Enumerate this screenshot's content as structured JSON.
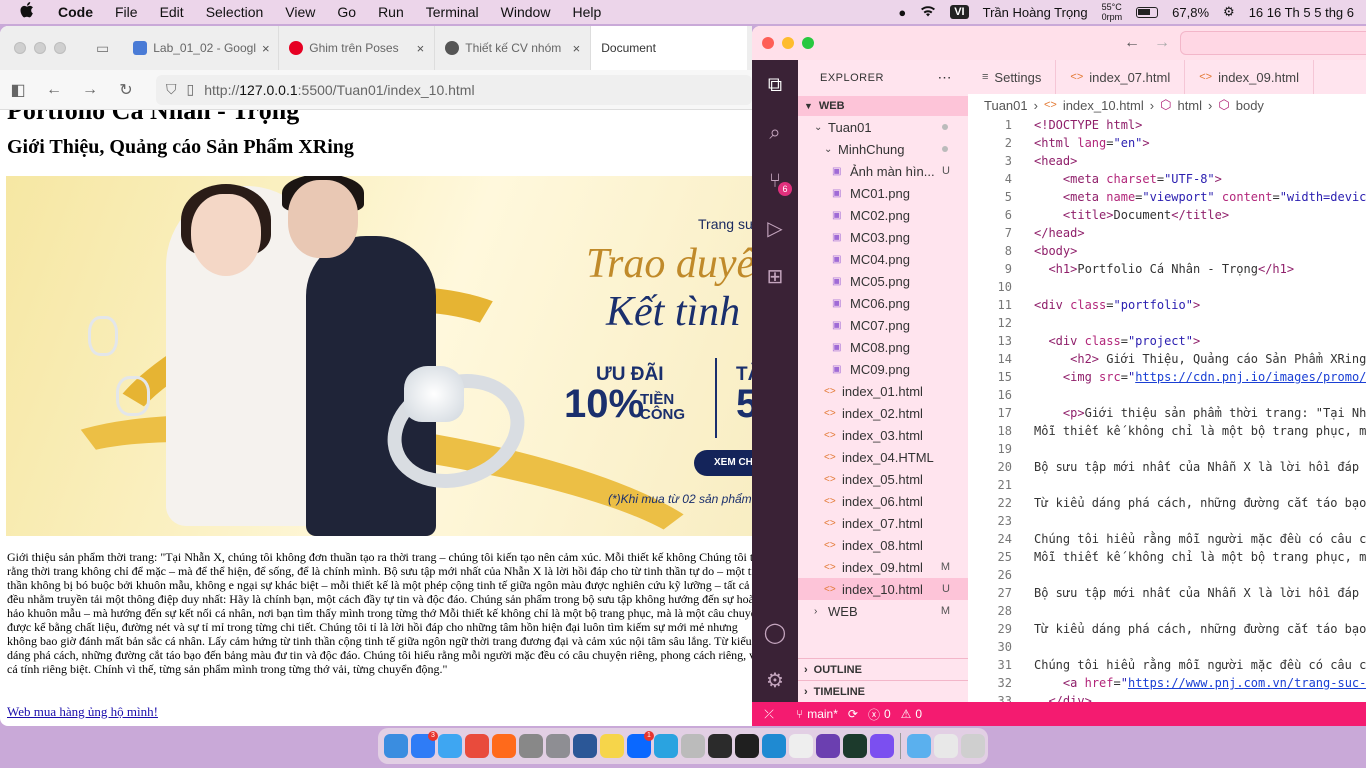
{
  "menubar": {
    "app_name": "Code",
    "items": [
      "File",
      "Edit",
      "Selection",
      "View",
      "Go",
      "Run",
      "Terminal",
      "Window",
      "Help"
    ],
    "input_method": "VI",
    "user_name": "Trần Hoàng Trọng",
    "temp": "55°C",
    "fan": "0rpm",
    "battery": "67,8%",
    "datetime": "16 16 Th 5 5 thg 6"
  },
  "browser": {
    "tabs": [
      {
        "label": "Lab_01_02 - Googl",
        "icon_color": "#4a7bd6"
      },
      {
        "label": "Ghim trên Poses",
        "icon_color": "#e60023"
      },
      {
        "label": "Thiết kế CV nhóm",
        "icon_color": "#555555"
      },
      {
        "label": "Document",
        "icon_color": ""
      }
    ],
    "url_prefix": "http://",
    "url_host": "127.0.0.1",
    "url_rest": ":5500/Tuan01/index_10.html"
  },
  "page": {
    "h1": "Portfolio Cá Nhân - Trọng",
    "h2": "Giới Thiệu, Quảng cáo Sản Phẩm XRing",
    "banner": {
      "trang": "Trang sư",
      "title1": "Trao duyên",
      "title2": "Kết tình T",
      "uudai": "ƯU ĐÃI",
      "pct": "10%",
      "tiencong": "TIỀN\nCÔNG",
      "t": "TẶ",
      "five": "5",
      "button": "XEM CH",
      "note": "(*)Khi mua từ 02 sản phẩm"
    },
    "description": "Giới thiệu sản phẩm thời trang: \"Tại Nhẫn X, chúng tôi không đơn thuần tạo ra thời trang – chúng tôi kiến tạo nên cảm xúc. Mỗi thiết kế không Chúng tôi tin rằng thời trang không chỉ để mặc – mà để thể hiện, để sống, để là chính mình. Bộ sưu tập mới nhất của Nhẫn X là lời hồi đáp cho từ tinh thần tự do – một tinh thần không bị bó buộc bởi khuôn mẫu, không e ngại sự khác biệt – mỗi thiết kế là một phép cộng tinh tế giữa ngôn màu được nghiên cứu kỹ lưỡng – tất cả đều nhằm truyền tải một thông điệp duy nhất: Hãy là chính bạn, một cách đầy tự tin và độc đáo. Chúng sản phẩm trong bộ sưu tập không hướng đến sự hoàn hảo khuôn mẫu – mà hướng đến sự kết nối cá nhân, nơi bạn tìm thấy mình trong từng thớ Mỗi thiết kế không chỉ là một bộ trang phục, mà là một câu chuyện được kể bằng chất liệu, đường nét và sự tỉ mỉ trong từng chi tiết. Chúng tôi tỉ là lời hồi đáp cho những tâm hồn hiện đại luôn tìm kiếm sự mới mẻ nhưng không bao giờ đánh mất bản sắc cá nhân. Lấy cảm hứng từ tinh thần cộng tinh tế giữa ngôn ngữ thời trang đương đại và cảm xúc nội tâm sâu lắng. Từ kiểu dáng phá cách, những đường cắt táo bạo đến bảng màu đư tin và độc đáo. Chúng tôi hiểu rằng mỗi người mặc đều có câu chuyện riêng, phong cách riêng, và cá tính riêng biệt. Chính vì thế, từng sản phẩm mình trong từng thớ vải, từng chuyển động.\"",
    "link": "Web mua hàng ủng hộ mình!"
  },
  "vscode": {
    "explorer_title": "EXPLORER",
    "workspace": "WEB",
    "tree": [
      {
        "label": "Tuan01",
        "type": "folder",
        "depth": 1,
        "open": true,
        "status": "",
        "dot": true
      },
      {
        "label": "MinhChung",
        "type": "folder",
        "depth": 2,
        "open": true,
        "status": "",
        "dot": true
      },
      {
        "label": "Ảnh màn hìn...",
        "type": "image",
        "depth": 3,
        "status": "U"
      },
      {
        "label": "MC01.png",
        "type": "image",
        "depth": 3,
        "status": ""
      },
      {
        "label": "MC02.png",
        "type": "image",
        "depth": 3,
        "status": ""
      },
      {
        "label": "MC03.png",
        "type": "image",
        "depth": 3,
        "status": ""
      },
      {
        "label": "MC04.png",
        "type": "image",
        "depth": 3,
        "status": ""
      },
      {
        "label": "MC05.png",
        "type": "image",
        "depth": 3,
        "status": ""
      },
      {
        "label": "MC06.png",
        "type": "image",
        "depth": 3,
        "status": ""
      },
      {
        "label": "MC07.png",
        "type": "image",
        "depth": 3,
        "status": ""
      },
      {
        "label": "MC08.png",
        "type": "image",
        "depth": 3,
        "status": ""
      },
      {
        "label": "MC09.png",
        "type": "image",
        "depth": 3,
        "status": ""
      },
      {
        "label": "index_01.html",
        "type": "html",
        "depth": 2,
        "status": ""
      },
      {
        "label": "index_02.html",
        "type": "html",
        "depth": 2,
        "status": ""
      },
      {
        "label": "index_03.html",
        "type": "html",
        "depth": 2,
        "status": ""
      },
      {
        "label": "index_04.HTML",
        "type": "html",
        "depth": 2,
        "status": ""
      },
      {
        "label": "index_05.html",
        "type": "html",
        "depth": 2,
        "status": ""
      },
      {
        "label": "index_06.html",
        "type": "html",
        "depth": 2,
        "status": ""
      },
      {
        "label": "index_07.html",
        "type": "html",
        "depth": 2,
        "status": ""
      },
      {
        "label": "index_08.html",
        "type": "html",
        "depth": 2,
        "status": ""
      },
      {
        "label": "index_09.html",
        "type": "html",
        "depth": 2,
        "status": "M"
      },
      {
        "label": "index_10.html",
        "type": "html",
        "depth": 2,
        "status": "U",
        "selected": true
      },
      {
        "label": "WEB",
        "type": "folder",
        "depth": 1,
        "open": false,
        "status": "M"
      }
    ],
    "outline": "OUTLINE",
    "timeline": "TIMELINE",
    "tabs": [
      {
        "label": "Settings",
        "icon": "≡"
      },
      {
        "label": "index_07.html",
        "icon": "<>"
      },
      {
        "label": "index_09.html",
        "icon": "<>"
      }
    ],
    "breadcrumb": [
      "Tuan01",
      "index_10.html",
      "html",
      "body"
    ],
    "scm_badge": "6",
    "status": {
      "branch": "main*",
      "errors": "0",
      "warnings": "0"
    },
    "code_lines": [
      {
        "n": "1",
        "html": "<span class=\"tg\">&lt;!DOCTYPE html&gt;</span>"
      },
      {
        "n": "2",
        "html": "<span class=\"tg\">&lt;html</span> <span class=\"at\">lang</span>=<span class=\"sv\">\"en\"</span><span class=\"tg\">&gt;</span>"
      },
      {
        "n": "3",
        "html": "<span class=\"tg\">&lt;head&gt;</span>"
      },
      {
        "n": "4",
        "html": "    <span class=\"tg\">&lt;meta</span> <span class=\"at\">charset</span>=<span class=\"sv\">\"UTF-8\"</span><span class=\"tg\">&gt;</span>"
      },
      {
        "n": "5",
        "html": "    <span class=\"tg\">&lt;meta</span> <span class=\"at\">name</span>=<span class=\"sv\">\"viewport\"</span> <span class=\"at\">content</span>=<span class=\"sv\">\"width=devic</span>"
      },
      {
        "n": "6",
        "html": "    <span class=\"tg\">&lt;title&gt;</span>Document<span class=\"tg\">&lt;/title&gt;</span>"
      },
      {
        "n": "7",
        "html": "<span class=\"tg\">&lt;/head&gt;</span>"
      },
      {
        "n": "8",
        "html": "<span class=\"tg\">&lt;body&gt;</span>"
      },
      {
        "n": "9",
        "html": "  <span class=\"tg\">&lt;h1&gt;</span>Portfolio Cá Nhân - Trọng<span class=\"tg\">&lt;/h1&gt;</span>"
      },
      {
        "n": "10",
        "html": ""
      },
      {
        "n": "11",
        "html": "<span class=\"tg\">&lt;div</span> <span class=\"at\">class</span>=<span class=\"sv\">\"portfolio\"</span><span class=\"tg\">&gt;</span>"
      },
      {
        "n": "12",
        "html": ""
      },
      {
        "n": "13",
        "html": "  <span class=\"tg\">&lt;div</span> <span class=\"at\">class</span>=<span class=\"sv\">\"project\"</span><span class=\"tg\">&gt;</span>"
      },
      {
        "n": "14",
        "html": "     <span class=\"tg\">&lt;h2&gt;</span> Giới Thiệu, Quảng cáo Sản Phẩm XRing"
      },
      {
        "n": "15",
        "html": "    <span class=\"tg\">&lt;img</span> <span class=\"at\">src</span>=<span class=\"sv\">\"</span><span class=\"lk\">https://cdn.pnj.io/images/promo/</span>"
      },
      {
        "n": "16",
        "html": ""
      },
      {
        "n": "17",
        "html": "    <span class=\"tg\">&lt;p&gt;</span>Giới thiệu sản phẩm thời trang: \"Tại Nh"
      },
      {
        "n": "18",
        "html": "Mỗi thiết kế không chỉ là một bộ trang phục, m"
      },
      {
        "n": "19",
        "html": ""
      },
      {
        "n": "20",
        "html": "Bộ sưu tập mới nhất của Nhẫn X là lời hồi đáp"
      },
      {
        "n": "21",
        "html": ""
      },
      {
        "n": "22",
        "html": "Từ kiểu dáng phá cách, những đường cắt táo bạo"
      },
      {
        "n": "23",
        "html": ""
      },
      {
        "n": "24",
        "html": "Chúng tôi hiểu rằng mỗi người mặc đều có câu c"
      },
      {
        "n": "25",
        "html": "Mỗi thiết kế không chỉ là một bộ trang phục, m"
      },
      {
        "n": "26",
        "html": ""
      },
      {
        "n": "27",
        "html": "Bộ sưu tập mới nhất của Nhẫn X là lời hồi đáp"
      },
      {
        "n": "28",
        "html": ""
      },
      {
        "n": "29",
        "html": "Từ kiểu dáng phá cách, những đường cắt táo bạo"
      },
      {
        "n": "30",
        "html": ""
      },
      {
        "n": "31",
        "html": "Chúng tôi hiểu rằng mỗi người mặc đều có câu c"
      },
      {
        "n": "32",
        "html": "    <span class=\"tg\">&lt;a</span> <span class=\"at\">href</span>=<span class=\"sv\">\"</span><span class=\"lk\">https://www.pnj.com.vn/trang-suc-</span>"
      },
      {
        "n": "33",
        "html": "  <span class=\"tg\">&lt;/div&gt;</span>"
      }
    ]
  },
  "dock": [
    {
      "name": "finder-icon",
      "color": "#3a8de0"
    },
    {
      "name": "app-store-icon",
      "color": "#2f7cf6",
      "badge": "3"
    },
    {
      "name": "safari-icon",
      "color": "#3ea6f2"
    },
    {
      "name": "chrome-icon",
      "color": "#e94b3c"
    },
    {
      "name": "firefox-icon",
      "color": "#ff6a1b"
    },
    {
      "name": "screenshot-icon",
      "color": "#888888"
    },
    {
      "name": "settings-icon",
      "color": "#8e8e93"
    },
    {
      "name": "word-icon",
      "color": "#2b5797"
    },
    {
      "name": "notes-icon",
      "color": "#f6d54a"
    },
    {
      "name": "zalo-icon",
      "color": "#0a68ff",
      "badge": "1"
    },
    {
      "name": "telegram-icon",
      "color": "#2aa3e0"
    },
    {
      "name": "pen-icon",
      "color": "#bbbbbb"
    },
    {
      "name": "terminal-icon",
      "color": "#2b2b2b"
    },
    {
      "name": "terminal2-icon",
      "color": "#1f1f1f"
    },
    {
      "name": "vscode-icon",
      "color": "#1f8ad2"
    },
    {
      "name": "textedit-icon",
      "color": "#eeeeee"
    },
    {
      "name": "github-icon",
      "color": "#6b3fb0"
    },
    {
      "name": "activity-monitor-icon",
      "color": "#1c3a2c"
    },
    {
      "name": "canva-icon",
      "color": "#7b4ff0"
    },
    {
      "name": "folder-icon",
      "color": "#5ab0ee"
    },
    {
      "name": "calendar-icon",
      "color": "#e8e8e8"
    },
    {
      "name": "trash-icon",
      "color": "#cfcfcf"
    }
  ]
}
